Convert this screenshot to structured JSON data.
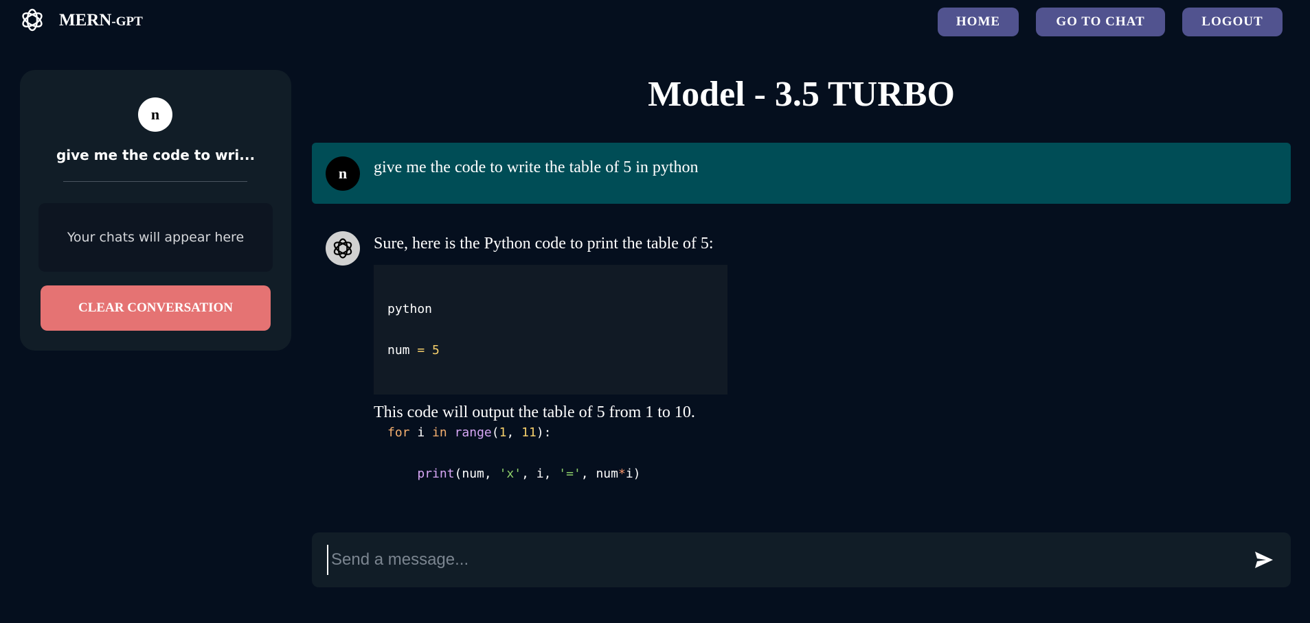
{
  "header": {
    "brand_main": "MERN",
    "brand_suffix": "-GPT",
    "logo_icon": "openai-logo-icon",
    "nav": {
      "home_label": "HOME",
      "chat_label": "GO TO CHAT",
      "logout_label": "LOGOUT"
    }
  },
  "sidebar": {
    "avatar_initial": "n",
    "chat_title": "give me the code to wri...",
    "chats_placeholder": "Your chats will appear here",
    "clear_label": "CLEAR CONVERSATION"
  },
  "main": {
    "title": "Model - 3.5 TURBO",
    "messages": [
      {
        "role": "user",
        "avatar_initial": "n",
        "text": "give me the code to write the table of 5 in python"
      },
      {
        "role": "assistant",
        "avatar_icon": "openai-logo-icon",
        "intro": "Sure, here is the Python code to print the table of 5:",
        "code_lines": [
          "python",
          "num = 5",
          "",
          "for i in range(1, 11):",
          "    print(num, 'x', i, '=', num*i)"
        ],
        "outro": "This code will output the table of 5 from 1 to 10."
      }
    ]
  },
  "composer": {
    "placeholder": "Send a message...",
    "value": "",
    "send_icon": "send-icon"
  },
  "colors": {
    "background": "#050f1e",
    "nav_button": "#51538f",
    "sidebar_bg": "#111d27",
    "clear_button": "#e57373",
    "user_message_bg": "#004d56",
    "code_bg": "#111a25"
  }
}
